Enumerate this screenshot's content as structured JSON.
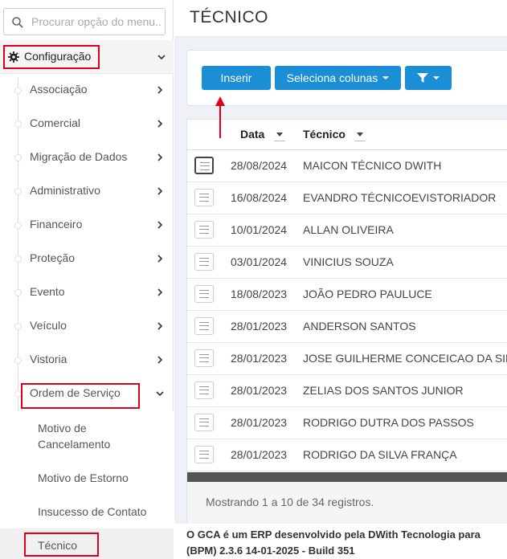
{
  "search": {
    "placeholder": "Procurar opção do menu..."
  },
  "sidebar": {
    "section_label": "Configuração",
    "items": [
      {
        "label": "Associação"
      },
      {
        "label": "Comercial"
      },
      {
        "label": "Migração de Dados"
      },
      {
        "label": "Administrativo"
      },
      {
        "label": "Financeiro"
      },
      {
        "label": "Proteção"
      },
      {
        "label": "Evento"
      },
      {
        "label": "Veículo"
      },
      {
        "label": "Vistoria"
      },
      {
        "label": "Ordem de Serviço"
      }
    ],
    "subitems": [
      {
        "label": "Motivo de Cancelamento"
      },
      {
        "label": "Motivo de Estorno"
      },
      {
        "label": "Insucesso de Contato"
      },
      {
        "label": "Técnico"
      }
    ]
  },
  "page": {
    "title": "TÉCNICO"
  },
  "toolbar": {
    "insert_label": "Inserir",
    "columns_label": "Seleciona colunas"
  },
  "table": {
    "columns": [
      "Data",
      "Técnico"
    ],
    "rows": [
      {
        "date": "28/08/2024",
        "name": "MAICON TÉCNICO DWITH"
      },
      {
        "date": "16/08/2024",
        "name": "EVANDRO TÉCNICOEVISTORIADOR"
      },
      {
        "date": "10/01/2024",
        "name": "ALLAN OLIVEIRA"
      },
      {
        "date": "03/01/2024",
        "name": "VINICIUS SOUZA"
      },
      {
        "date": "18/08/2023",
        "name": "JOÃO PEDRO PAULUCE"
      },
      {
        "date": "28/01/2023",
        "name": "ANDERSON SANTOS"
      },
      {
        "date": "28/01/2023",
        "name": "JOSE GUILHERME CONCEICAO DA SIL"
      },
      {
        "date": "28/01/2023",
        "name": "ZELIAS DOS SANTOS JUNIOR"
      },
      {
        "date": "28/01/2023",
        "name": "RODRIGO DUTRA DOS PASSOS"
      },
      {
        "date": "28/01/2023",
        "name": "RODRIGO DA SILVA FRANÇA"
      }
    ],
    "info": "Mostrando 1 a 10 de 34 registros."
  },
  "footer": {
    "line1": "O GCA é um ERP desenvolvido pela DWith Tecnologia para",
    "line2": "(BPM) 2.3.6 14-01-2025 - Build 351"
  },
  "colors": {
    "primary": "#1a8fd6",
    "highlight": "#e0001b"
  }
}
